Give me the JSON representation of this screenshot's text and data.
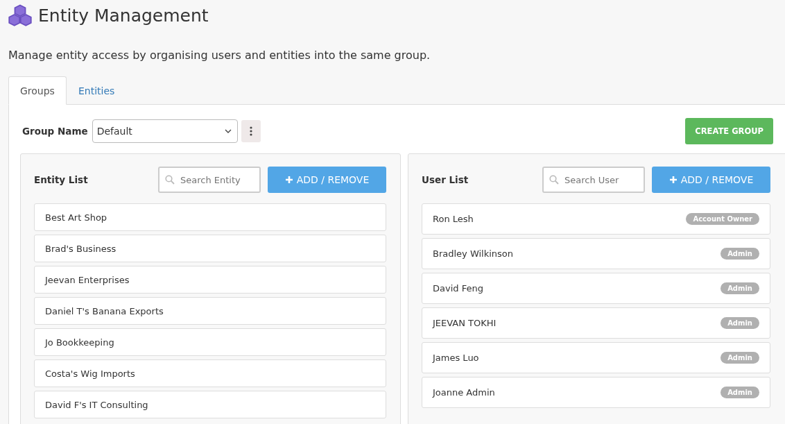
{
  "page": {
    "title": "Entity Management",
    "description": "Manage entity access by organising users and entities into the same group."
  },
  "tabs": [
    {
      "label": "Groups",
      "selected": true
    },
    {
      "label": "Entities",
      "selected": false
    }
  ],
  "group": {
    "label": "Group Name",
    "value": "Default",
    "create_button": "CREATE GROUP"
  },
  "entity_list": {
    "title": "Entity List",
    "search_placeholder": "Search Entity",
    "button": "ADD / REMOVE",
    "items": [
      "Best Art Shop",
      "Brad's Business",
      "Jeevan Enterprises",
      "Daniel T's Banana Exports",
      "Jo Bookkeeping",
      "Costa's Wig Imports",
      "David F's IT Consulting"
    ]
  },
  "user_list": {
    "title": "User List",
    "search_placeholder": "Search User",
    "button": "ADD / REMOVE",
    "items": [
      {
        "name": "Ron Lesh",
        "role": "Account Owner"
      },
      {
        "name": "Bradley Wilkinson",
        "role": "Admin"
      },
      {
        "name": "David Feng",
        "role": "Admin"
      },
      {
        "name": "JEEVAN TOKHI",
        "role": "Admin"
      },
      {
        "name": "James Luo",
        "role": "Admin"
      },
      {
        "name": "Joanne Admin",
        "role": "Admin"
      }
    ]
  }
}
